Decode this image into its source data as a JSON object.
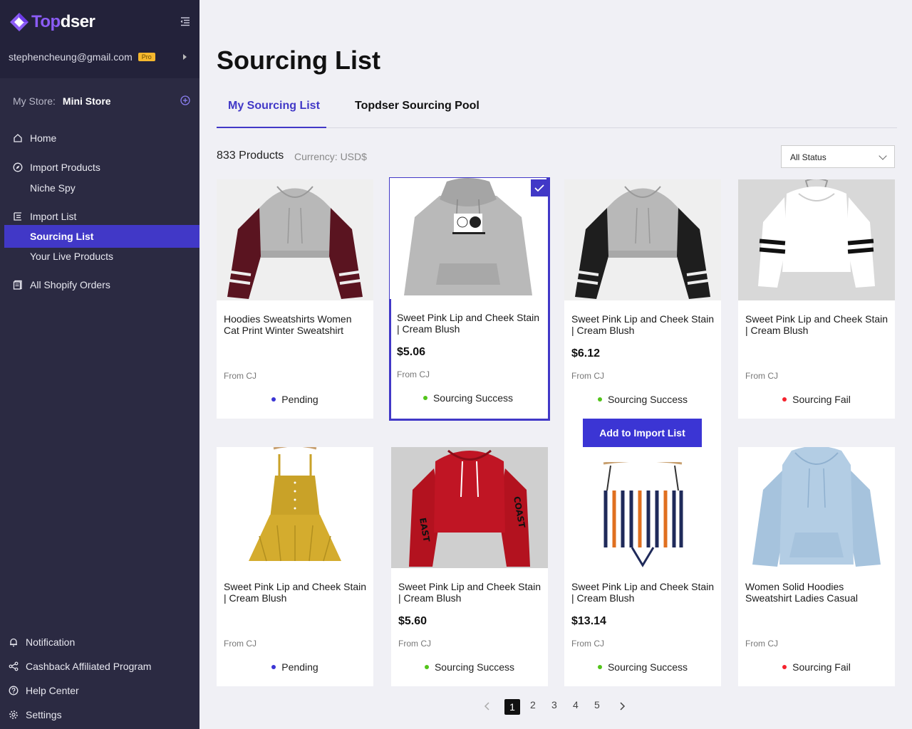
{
  "brand": {
    "name_part1": "Top",
    "name_part2": "dser"
  },
  "account": {
    "email": "stephencheung@gmail.com",
    "badge": "Pro"
  },
  "store": {
    "label": "My Store:",
    "name": "Mini Store"
  },
  "nav": {
    "home": "Home",
    "import_products": "Import Products",
    "niche_spy": "Niche Spy",
    "import_list": "Import List",
    "sourcing_list": "Sourcing List",
    "live_products": "Your Live Products",
    "shopify_orders": "All Shopify Orders"
  },
  "bottom_nav": {
    "notification": "Notification",
    "cashback": "Cashback Affiliated Program",
    "help": "Help Center",
    "settings": "Settings"
  },
  "page": {
    "title": "Sourcing List",
    "tabs": [
      "My Sourcing List",
      "Topdser Sourcing Pool"
    ],
    "count": "833 Products",
    "currency": "Currency: USD$",
    "status_filter": "All Status",
    "add_button": "Add to Import List"
  },
  "products": [
    {
      "title": "Hoodies Sweatshirts Women Cat Print Winter Sweatshirt",
      "price": "",
      "source": "From CJ",
      "status": "Pending"
    },
    {
      "title": "Sweet Pink Lip and Cheek Stain | Cream Blush",
      "price": "$5.06",
      "source": "From CJ",
      "status": "Sourcing Success"
    },
    {
      "title": "Sweet Pink Lip and Cheek Stain | Cream Blush",
      "price": "$6.12",
      "source": "From CJ",
      "status": "Sourcing Success"
    },
    {
      "title": "Sweet Pink Lip and Cheek Stain | Cream Blush",
      "price": "",
      "source": "From CJ",
      "status": "Sourcing Fail"
    },
    {
      "title": "Sweet Pink Lip and Cheek Stain | Cream Blush",
      "price": "",
      "source": "From CJ",
      "status": "Pending"
    },
    {
      "title": "Sweet Pink Lip and Cheek Stain | Cream Blush",
      "price": "$5.60",
      "source": "From CJ",
      "status": "Sourcing Success"
    },
    {
      "title": "Sweet Pink Lip and Cheek Stain | Cream Blush",
      "price": "$13.14",
      "source": "From CJ",
      "status": "Sourcing Success"
    },
    {
      "title": "Women Solid Hoodies Sweatshirt Ladies Casual",
      "price": "",
      "source": "From CJ",
      "status": "Sourcing Fail"
    }
  ],
  "status_colors": {
    "pending": "#3b35d4",
    "success": "#52c41a",
    "fail": "#f5222d"
  },
  "accent": "#4138c7",
  "pagination": {
    "pages": [
      "1",
      "2",
      "3",
      "4",
      "5"
    ],
    "current": "1"
  }
}
